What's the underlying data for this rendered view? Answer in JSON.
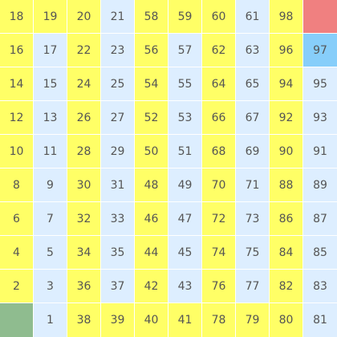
{
  "palette": {
    "yellow": "#ffff66",
    "blue": "#ddeeff",
    "start": "#8fbc8f",
    "goal": "#f08080",
    "current": "#87cefa"
  },
  "board": {
    "rows": [
      [
        {
          "label": "18",
          "color": "yellow"
        },
        {
          "label": "19",
          "color": "yellow"
        },
        {
          "label": "20",
          "color": "yellow"
        },
        {
          "label": "21",
          "color": "blue"
        },
        {
          "label": "58",
          "color": "yellow"
        },
        {
          "label": "59",
          "color": "yellow"
        },
        {
          "label": "60",
          "color": "yellow"
        },
        {
          "label": "61",
          "color": "blue"
        },
        {
          "label": "98",
          "color": "yellow"
        },
        {
          "label": "",
          "color": "goal"
        }
      ],
      [
        {
          "label": "16",
          "color": "yellow"
        },
        {
          "label": "17",
          "color": "blue"
        },
        {
          "label": "22",
          "color": "yellow"
        },
        {
          "label": "23",
          "color": "blue"
        },
        {
          "label": "56",
          "color": "yellow"
        },
        {
          "label": "57",
          "color": "blue"
        },
        {
          "label": "62",
          "color": "yellow"
        },
        {
          "label": "63",
          "color": "blue"
        },
        {
          "label": "96",
          "color": "yellow"
        },
        {
          "label": "97",
          "color": "current"
        }
      ],
      [
        {
          "label": "14",
          "color": "yellow"
        },
        {
          "label": "15",
          "color": "blue"
        },
        {
          "label": "24",
          "color": "yellow"
        },
        {
          "label": "25",
          "color": "blue"
        },
        {
          "label": "54",
          "color": "yellow"
        },
        {
          "label": "55",
          "color": "blue"
        },
        {
          "label": "64",
          "color": "yellow"
        },
        {
          "label": "65",
          "color": "blue"
        },
        {
          "label": "94",
          "color": "yellow"
        },
        {
          "label": "95",
          "color": "blue"
        }
      ],
      [
        {
          "label": "12",
          "color": "yellow"
        },
        {
          "label": "13",
          "color": "blue"
        },
        {
          "label": "26",
          "color": "yellow"
        },
        {
          "label": "27",
          "color": "blue"
        },
        {
          "label": "52",
          "color": "yellow"
        },
        {
          "label": "53",
          "color": "blue"
        },
        {
          "label": "66",
          "color": "yellow"
        },
        {
          "label": "67",
          "color": "blue"
        },
        {
          "label": "92",
          "color": "yellow"
        },
        {
          "label": "93",
          "color": "blue"
        }
      ],
      [
        {
          "label": "10",
          "color": "yellow"
        },
        {
          "label": "11",
          "color": "blue"
        },
        {
          "label": "28",
          "color": "yellow"
        },
        {
          "label": "29",
          "color": "blue"
        },
        {
          "label": "50",
          "color": "yellow"
        },
        {
          "label": "51",
          "color": "blue"
        },
        {
          "label": "68",
          "color": "yellow"
        },
        {
          "label": "69",
          "color": "blue"
        },
        {
          "label": "90",
          "color": "yellow"
        },
        {
          "label": "91",
          "color": "blue"
        }
      ],
      [
        {
          "label": "8",
          "color": "yellow"
        },
        {
          "label": "9",
          "color": "blue"
        },
        {
          "label": "30",
          "color": "yellow"
        },
        {
          "label": "31",
          "color": "blue"
        },
        {
          "label": "48",
          "color": "yellow"
        },
        {
          "label": "49",
          "color": "blue"
        },
        {
          "label": "70",
          "color": "yellow"
        },
        {
          "label": "71",
          "color": "blue"
        },
        {
          "label": "88",
          "color": "yellow"
        },
        {
          "label": "89",
          "color": "blue"
        }
      ],
      [
        {
          "label": "6",
          "color": "yellow"
        },
        {
          "label": "7",
          "color": "blue"
        },
        {
          "label": "32",
          "color": "yellow"
        },
        {
          "label": "33",
          "color": "blue"
        },
        {
          "label": "46",
          "color": "yellow"
        },
        {
          "label": "47",
          "color": "blue"
        },
        {
          "label": "72",
          "color": "yellow"
        },
        {
          "label": "73",
          "color": "blue"
        },
        {
          "label": "86",
          "color": "yellow"
        },
        {
          "label": "87",
          "color": "blue"
        }
      ],
      [
        {
          "label": "4",
          "color": "yellow"
        },
        {
          "label": "5",
          "color": "blue"
        },
        {
          "label": "34",
          "color": "yellow"
        },
        {
          "label": "35",
          "color": "blue"
        },
        {
          "label": "44",
          "color": "yellow"
        },
        {
          "label": "45",
          "color": "blue"
        },
        {
          "label": "74",
          "color": "yellow"
        },
        {
          "label": "75",
          "color": "blue"
        },
        {
          "label": "84",
          "color": "yellow"
        },
        {
          "label": "85",
          "color": "blue"
        }
      ],
      [
        {
          "label": "2",
          "color": "yellow"
        },
        {
          "label": "3",
          "color": "blue"
        },
        {
          "label": "36",
          "color": "yellow"
        },
        {
          "label": "37",
          "color": "blue"
        },
        {
          "label": "42",
          "color": "yellow"
        },
        {
          "label": "43",
          "color": "blue"
        },
        {
          "label": "76",
          "color": "yellow"
        },
        {
          "label": "77",
          "color": "blue"
        },
        {
          "label": "82",
          "color": "yellow"
        },
        {
          "label": "83",
          "color": "blue"
        }
      ],
      [
        {
          "label": "",
          "color": "start"
        },
        {
          "label": "1",
          "color": "blue"
        },
        {
          "label": "38",
          "color": "yellow"
        },
        {
          "label": "39",
          "color": "yellow"
        },
        {
          "label": "40",
          "color": "yellow"
        },
        {
          "label": "41",
          "color": "yellow"
        },
        {
          "label": "78",
          "color": "yellow"
        },
        {
          "label": "79",
          "color": "yellow"
        },
        {
          "label": "80",
          "color": "yellow"
        },
        {
          "label": "81",
          "color": "blue"
        }
      ]
    ]
  }
}
